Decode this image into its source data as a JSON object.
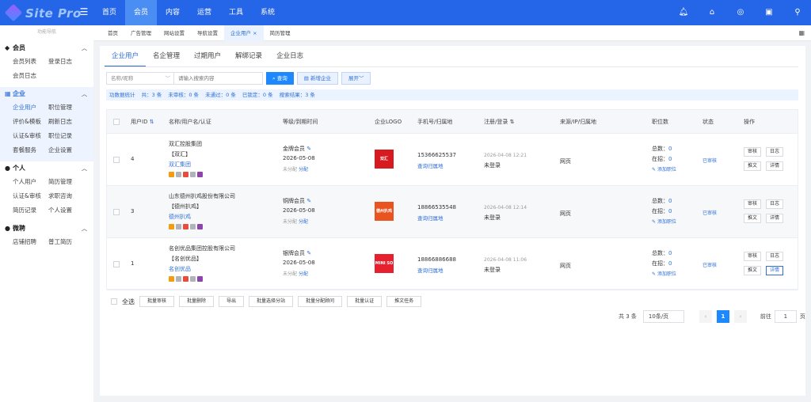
{
  "app": {
    "logo_text": "Site Pro"
  },
  "topnav": [
    "首页",
    "会员",
    "内容",
    "运营",
    "工具",
    "系统"
  ],
  "colors": {
    "primary": "#2566e8",
    "accent": "#1e88ff",
    "link": "#2f6fd6"
  },
  "sidebar": {
    "header": "功能导航",
    "groups": [
      {
        "title": "会员",
        "icon": "diamond-icon",
        "items": [
          "会员列表",
          "登录日志",
          "会员日志"
        ]
      },
      {
        "title": "企业",
        "icon": "building-icon",
        "items": [
          "企业用户",
          "职位管理",
          "评价&模板",
          "刷新日志",
          "认证&审核",
          "职位记录",
          "套餐服务",
          "企业设置"
        ]
      },
      {
        "title": "个人",
        "icon": "person-icon",
        "items": [
          "个人用户",
          "简历管理",
          "认证&审核",
          "求职咨询",
          "简历记录",
          "个人设置"
        ]
      },
      {
        "title": "微聘",
        "icon": "people-icon",
        "items": [
          "店铺招聘",
          "普工简历"
        ]
      }
    ]
  },
  "tabs": [
    "首页",
    "广告管理",
    "网站设置",
    "导航设置",
    "企业用户",
    "简历管理"
  ],
  "subtabs": [
    "企业用户",
    "名企管理",
    "过期用户",
    "解绑记录",
    "企业日志"
  ],
  "search": {
    "select_placeholder": "名称/昵称",
    "keyword_placeholder": "请输入搜索内容",
    "query": "查询",
    "add": "新增企业",
    "expand": "展开"
  },
  "stats": {
    "label": "功数据统计",
    "total": "共：3 条",
    "pending": "未审核：0 条",
    "rejected": "未通过：0 条",
    "locked": "已锁定：0 条",
    "results": "搜索结果：3 条"
  },
  "columns": {
    "id": "用户ID",
    "name": "名称/用户名/认证",
    "level": "等级/到期时间",
    "logo": "企业LOGO",
    "phone": "手机号/归属地",
    "reg": "注册/登录",
    "source": "来源/IP/归属地",
    "jobs": "职位数",
    "status": "状态",
    "ops": "操作"
  },
  "rows": [
    {
      "id": "4",
      "company": "双汇控股集团",
      "short": "【双汇】",
      "username": "双汇集团",
      "level": "金牌会员",
      "expire": "2026-05-08",
      "assign_state": "未分配",
      "assign": "分配",
      "logo_text": "双汇",
      "logo_color": "#d71920",
      "phone": "15366625537",
      "phone_link": "查询归属地",
      "reg_time": "2026-04-08 12:21",
      "login": "未登录",
      "source": "网页",
      "total_label": "总数：",
      "total": "0",
      "hiring_label": "在招：",
      "hiring": "0",
      "add_job": "添加职位",
      "status": "已审核"
    },
    {
      "id": "3",
      "company": "山东德州扒鸡股份有限公司",
      "short": "【德州扒鸡】",
      "username": "德州扒鸡",
      "level": "铜牌会员",
      "expire": "2026-05-08",
      "assign_state": "未分配",
      "assign": "分配",
      "logo_text": "德州扒鸡",
      "logo_color": "#e8531f",
      "phone": "18866535548",
      "phone_link": "查询归属地",
      "reg_time": "2026-04-08 12:14",
      "login": "未登录",
      "source": "网页",
      "total_label": "总数：",
      "total": "0",
      "hiring_label": "在招：",
      "hiring": "0",
      "add_job": "添加职位",
      "status": "已审核"
    },
    {
      "id": "1",
      "company": "名创优品集团控股有限公司",
      "short": "【名创优品】",
      "username": "名创优品",
      "level": "银牌会员",
      "expire": "2026-05-08",
      "assign_state": "未分配",
      "assign": "分配",
      "logo_text": "MINI SO",
      "logo_color": "#e6202e",
      "phone": "18866886688",
      "phone_link": "查询归属地",
      "reg_time": "2026-04-08 11:06",
      "login": "未登录",
      "source": "网页",
      "total_label": "总数：",
      "total": "0",
      "hiring_label": "在招：",
      "hiring": "0",
      "add_job": "添加职位",
      "status": "已审核"
    }
  ],
  "row_ops": [
    "审核",
    "日志",
    "推文",
    "详情"
  ],
  "bulk": {
    "select_all": "全选",
    "buttons": [
      "批量审核",
      "批量删除",
      "导出",
      "批量选择分站",
      "批量分配顾问",
      "批量认证",
      "推文任务"
    ]
  },
  "pager": {
    "total": "共 3 条",
    "size": "10条/页",
    "page": "1",
    "goto": "前往",
    "goto_value": "1",
    "unit": "页"
  }
}
